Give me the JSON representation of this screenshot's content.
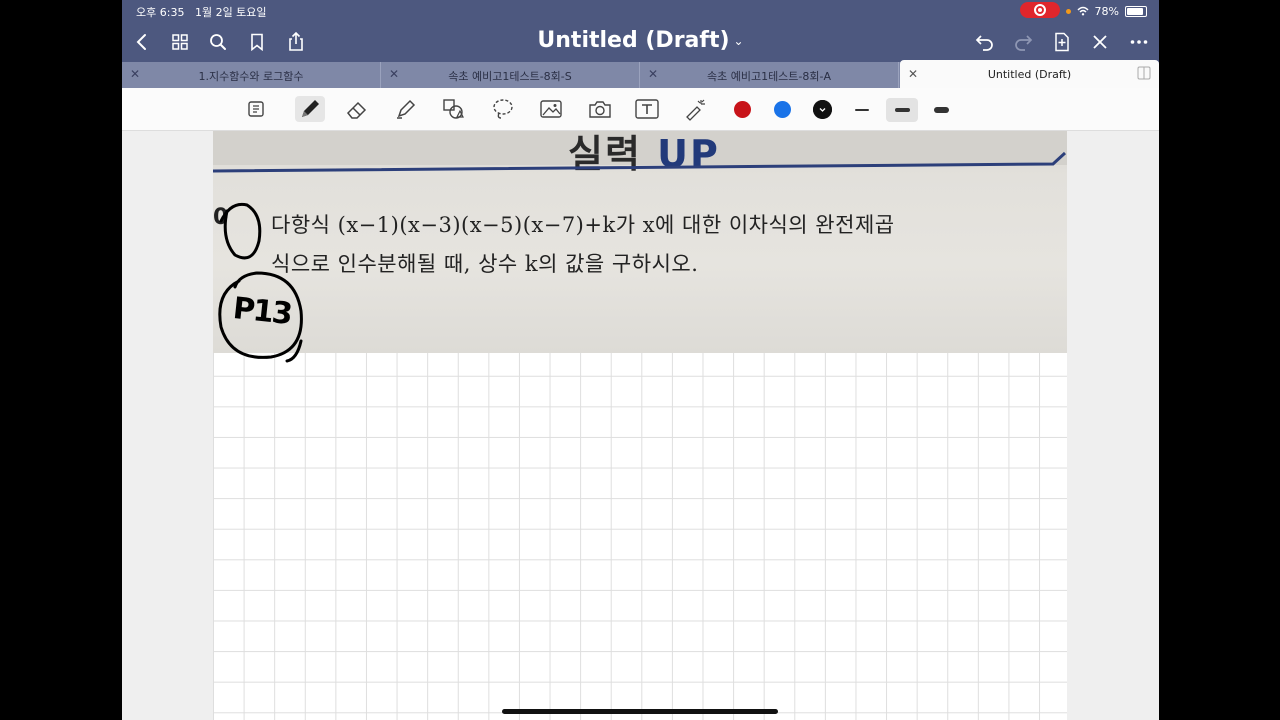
{
  "status": {
    "time": "오후 6:35",
    "date": "1월 2일 토요일",
    "battery": "78%"
  },
  "nav": {
    "title": "Untitled (Draft)",
    "title_chevron": "⌄"
  },
  "tabs": [
    {
      "label": "1.지수함수와 로그함수",
      "active": false
    },
    {
      "label": "속초 예비고1테스트-8회-S",
      "active": false
    },
    {
      "label": "속초 예비고1테스트-8회-A",
      "active": false
    },
    {
      "label": "Untitled (Draft)",
      "active": true
    }
  ],
  "toolbar": {
    "colors": [
      "#c8141a",
      "#1a73e8",
      "#111111"
    ],
    "selected_color_index": 2,
    "thickness_selected_index": 1
  },
  "document": {
    "heading_left": "실력",
    "heading_right": "UP",
    "problem_number": "0",
    "problem_line1": "다항식 (x−1)(x−3)(x−5)(x−7)+k가 x에 대한 이차식의 완전제곱",
    "problem_line2": "식으로 인수분해될 때, 상수 k의 값을 구하시오.",
    "handwritten_note": "P13"
  }
}
